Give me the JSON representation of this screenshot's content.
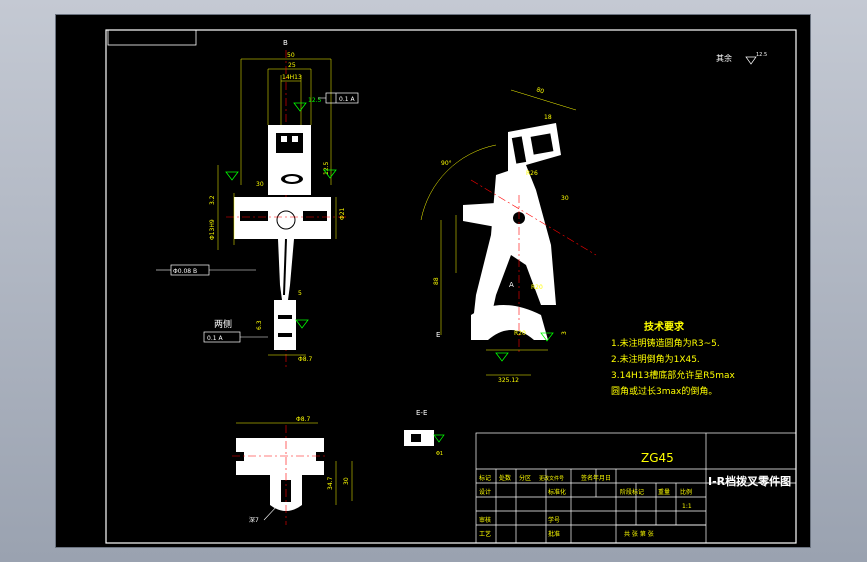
{
  "drawing": {
    "top_view_label": "B",
    "dims_top": [
      "50",
      "25",
      "14H13"
    ],
    "roughness_note_top": "12.5",
    "frame_ref": "0.1 A",
    "side_dims": [
      "30",
      "12.5"
    ],
    "left_callouts": [
      "3.2",
      "Φ13H9"
    ],
    "left_bottom_callout": "Φ0.08 B",
    "shaft_dims": [
      "5",
      "6.3",
      "Φ8.7"
    ],
    "both_sides_label": "两侧",
    "both_sides_box": "0.1 A",
    "rough_label": "6.3",
    "fork_dims": [
      "80",
      "18",
      "R26",
      "30",
      "R20",
      "88",
      "E",
      "A",
      "R20",
      "3",
      "325.12"
    ],
    "angle": "90°",
    "bottom_view_dims": [
      "Φ8.7",
      "34.7",
      "30"
    ],
    "bottom_view_label": "深7",
    "section_label": "E-E",
    "section_dim": "Φ1",
    "surface_note": "其余",
    "surface_sym": "12.5"
  },
  "notes": {
    "title": "技术要求",
    "line1": "1.未注明铸造圆角为R3~5.",
    "line2": "2.未注明倒角为1X45.",
    "line3": "3.14H13槽底部允许呈R5max",
    "line4": "圆角或过长3max的倒角。"
  },
  "title_block": {
    "material": "ZG45",
    "part_name": "I-R档拨叉零件图",
    "row1": [
      "标记",
      "处数",
      "分区",
      "更改文件号",
      "签名",
      "年月日"
    ],
    "design": "设计",
    "std": "标准化",
    "stage_label": "阶段标记",
    "weight_label": "重量",
    "scale_label": "比例",
    "scale": "1:1",
    "review": "审核",
    "craft": "工艺",
    "approve": "批准",
    "student_no": "学号",
    "sheet": "共  张 第  张"
  }
}
